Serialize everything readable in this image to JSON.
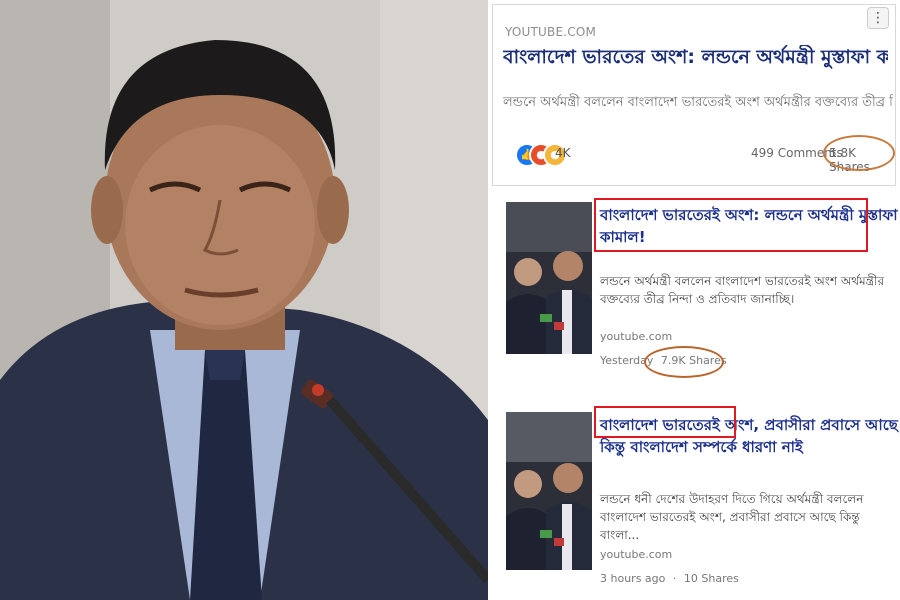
{
  "photo": {
    "description_icon": "person-at-microphone-photo"
  },
  "fb_card": {
    "menu_icon": "more-options-icon",
    "source": "YOUTUBE.COM",
    "title": "বাংলাদেশ ভারতের অংশ: লন্ডনে অর্থমন্ত্রী মুস্তাফা কামাল!",
    "description": "লন্ডনে অর্থমন্ত্রী বললেন বাংলাদেশ ভারতেরই অংশ অর্থমন্ত্রীর বক্তব্যের তীব্র নিন্দা",
    "reaction_count": "4K",
    "comments": "499 Comments",
    "shares": "5.8K Shares"
  },
  "results": [
    {
      "title": "বাংলাদেশ ভারতেরই অংশ: লন্ডনে অর্থমন্ত্রী মুস্তাফা কামাল!",
      "description": "লন্ডনে অর্থমন্ত্রী বললেন বাংলাদেশ ভারতেরই অংশ অর্থমন্ত্রীর বক্তব্যের তীব্র নিন্দা ও প্রতিবাদ জানাচ্ছি।",
      "source": "youtube.com",
      "time": "Yesterday",
      "shares": "7.9K Shares"
    },
    {
      "title_highlight": "বাংলাদেশ ভারতেরই অংশ,",
      "title_rest": " প্রবাসীরা প্রবাসে আছে কিন্তু বাংলাদেশ সম্পর্কে ধারণা নাই",
      "description": "লন্ডনে ধনী দেশের উদাহরণ দিতে গিয়ে অর্থমন্ত্রী বললেন বাংলাদেশ ভারতেরই অংশ, প্রবাসীরা প্রবাসে আছে কিন্তু বাংলা...",
      "source": "youtube.com",
      "time": "3 hours ago",
      "separator": "·",
      "shares": "10 Shares"
    }
  ],
  "colors": {
    "title_blue": "#1b2f78",
    "highlight_red": "#e01a22",
    "circle_orange": "#c87a3c"
  }
}
